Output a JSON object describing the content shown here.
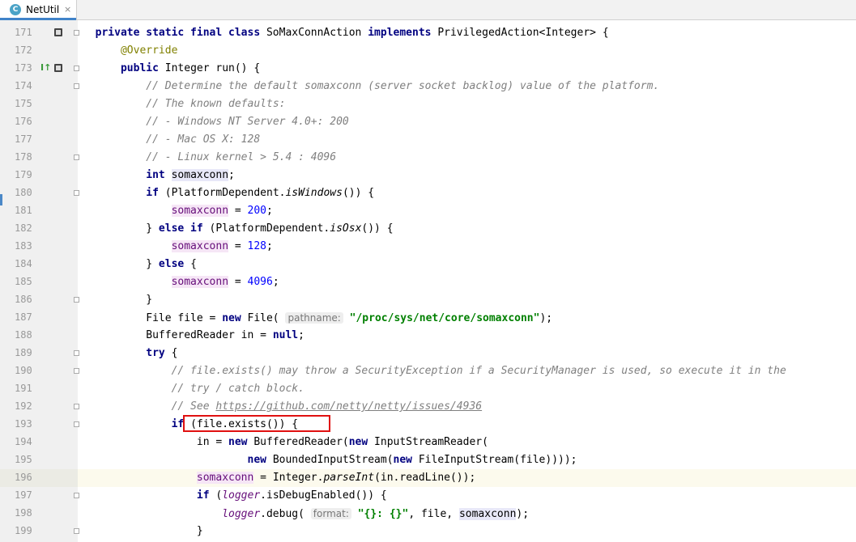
{
  "tab": {
    "filename": "NetUtil",
    "close_glyph": "×",
    "class_icon": "C"
  },
  "lines": [
    {
      "n": "171",
      "t": [
        [
          "  "
        ],
        [
          "private static final class ",
          "kw"
        ],
        [
          "SoMaxConnAction "
        ],
        [
          "implements",
          "kw"
        ],
        [
          " PrivilegedAction<Integer> {"
        ]
      ]
    },
    {
      "n": "172",
      "t": [
        [
          "      "
        ],
        [
          "@Override",
          "an"
        ]
      ]
    },
    {
      "n": "173",
      "t": [
        [
          "      "
        ],
        [
          "public ",
          "kw"
        ],
        [
          "Integer run() {"
        ]
      ]
    },
    {
      "n": "174",
      "t": [
        [
          "          "
        ],
        [
          "// Determine the default somaxconn (server socket backlog) value of the platform.",
          "cm"
        ]
      ]
    },
    {
      "n": "175",
      "t": [
        [
          "          "
        ],
        [
          "// The known defaults:",
          "cm"
        ]
      ]
    },
    {
      "n": "176",
      "t": [
        [
          "          "
        ],
        [
          "// - Windows NT Server 4.0+: 200",
          "cm"
        ]
      ]
    },
    {
      "n": "177",
      "t": [
        [
          "          "
        ],
        [
          "// - Mac OS X: 128",
          "cm"
        ]
      ]
    },
    {
      "n": "178",
      "t": [
        [
          "          "
        ],
        [
          "// - Linux kernel > 5.4 : 4096",
          "cm"
        ]
      ]
    },
    {
      "n": "179",
      "t": [
        [
          "          "
        ],
        [
          "int ",
          "kw"
        ],
        [
          "somaxconn",
          "fldref"
        ],
        [
          ";"
        ]
      ]
    },
    {
      "n": "180",
      "t": [
        [
          "          "
        ],
        [
          "if ",
          "kw"
        ],
        [
          "(PlatformDependent."
        ],
        [
          "isWindows",
          "it"
        ],
        [
          "()) {"
        ]
      ]
    },
    {
      "n": "181",
      "t": [
        [
          "              "
        ],
        [
          "somaxconn",
          "fld"
        ],
        [
          " = "
        ],
        [
          "200",
          "num"
        ],
        [
          ";"
        ]
      ]
    },
    {
      "n": "182",
      "t": [
        [
          "          } "
        ],
        [
          "else if ",
          "kw"
        ],
        [
          "(PlatformDependent."
        ],
        [
          "isOsx",
          "it"
        ],
        [
          "()) {"
        ]
      ]
    },
    {
      "n": "183",
      "t": [
        [
          "              "
        ],
        [
          "somaxconn",
          "fld"
        ],
        [
          " = "
        ],
        [
          "128",
          "num"
        ],
        [
          ";"
        ]
      ]
    },
    {
      "n": "184",
      "t": [
        [
          "          } "
        ],
        [
          "else ",
          "kw"
        ],
        [
          "{"
        ]
      ]
    },
    {
      "n": "185",
      "t": [
        [
          "              "
        ],
        [
          "somaxconn",
          "fld"
        ],
        [
          " = "
        ],
        [
          "4096",
          "num"
        ],
        [
          ";"
        ]
      ]
    },
    {
      "n": "186",
      "t": [
        [
          "          }"
        ]
      ]
    },
    {
      "n": "187",
      "t": [
        [
          "          File file = "
        ],
        [
          "new ",
          "kw"
        ],
        [
          "File( "
        ],
        [
          "pathname:",
          "hint"
        ],
        [
          " "
        ],
        [
          "\"/proc/sys/net/core/somaxconn\"",
          "str"
        ],
        [
          ");"
        ]
      ]
    },
    {
      "n": "188",
      "t": [
        [
          "          BufferedReader in = "
        ],
        [
          "null",
          "kw"
        ],
        [
          ";"
        ]
      ]
    },
    {
      "n": "189",
      "t": [
        [
          "          "
        ],
        [
          "try ",
          "kw"
        ],
        [
          "{"
        ]
      ]
    },
    {
      "n": "190",
      "t": [
        [
          "              "
        ],
        [
          "// file.exists() may throw a SecurityException if a SecurityManager is used, so execute it in the",
          "cm"
        ]
      ]
    },
    {
      "n": "191",
      "t": [
        [
          "              "
        ],
        [
          "// try / catch block.",
          "cm"
        ]
      ]
    },
    {
      "n": "192",
      "t": [
        [
          "              "
        ],
        [
          "// See ",
          "cm"
        ],
        [
          "https://github.com/netty/netty/issues/4936",
          "cm link"
        ]
      ]
    },
    {
      "n": "193",
      "t": [
        [
          "              "
        ],
        [
          "if ",
          "kw"
        ],
        [
          "(file.exists()) {"
        ]
      ]
    },
    {
      "n": "194",
      "t": [
        [
          "                  in = "
        ],
        [
          "new ",
          "kw"
        ],
        [
          "BufferedReader("
        ],
        [
          "new ",
          "kw"
        ],
        [
          "InputStreamReader("
        ]
      ]
    },
    {
      "n": "195",
      "t": [
        [
          "                          "
        ],
        [
          "new ",
          "kw"
        ],
        [
          "BoundedInputStream("
        ],
        [
          "new ",
          "kw"
        ],
        [
          "FileInputStream(file))));"
        ]
      ]
    },
    {
      "n": "196",
      "t": [
        [
          "                  "
        ],
        [
          "somaxconn",
          "fld"
        ],
        [
          " = Integer."
        ],
        [
          "parseInt",
          "it"
        ],
        [
          "(in.readLine());"
        ]
      ]
    },
    {
      "n": "197",
      "t": [
        [
          "                  "
        ],
        [
          "if ",
          "kw"
        ],
        [
          "("
        ],
        [
          "logger",
          "itf"
        ],
        [
          ".isDebugEnabled()) {"
        ]
      ]
    },
    {
      "n": "198",
      "t": [
        [
          "                      "
        ],
        [
          "logger",
          "itf"
        ],
        [
          ".debug( "
        ],
        [
          "format:",
          "hint"
        ],
        [
          " "
        ],
        [
          "\"{}: {}\"",
          "str"
        ],
        [
          ", file, "
        ],
        [
          "somaxconn",
          "fldref"
        ],
        [
          ");"
        ]
      ]
    },
    {
      "n": "199",
      "t": [
        [
          "                  }"
        ]
      ]
    }
  ]
}
